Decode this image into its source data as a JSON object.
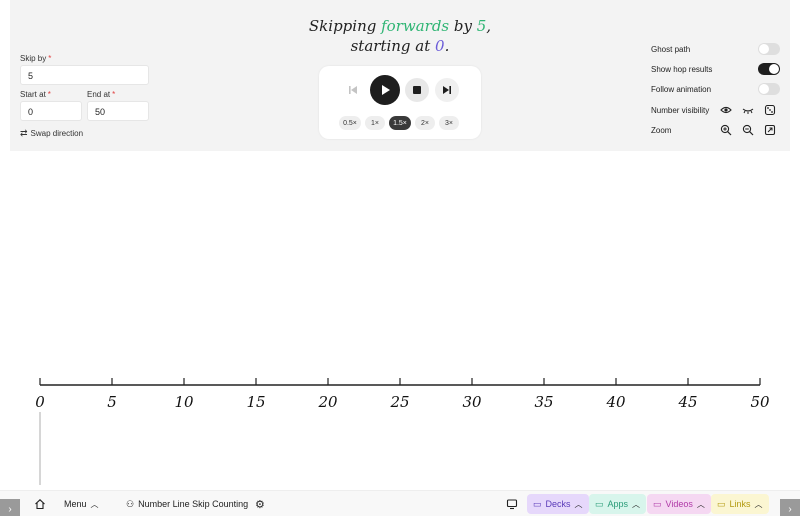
{
  "title": {
    "line1_pre": "Skipping ",
    "line1_dir": "forwards",
    "line1_mid": " by ",
    "line1_step": "5",
    "line1_end": ",",
    "line2_pre": "starting at ",
    "line2_start": "0",
    "line2_end": "."
  },
  "form": {
    "skip_by_label": "Skip by",
    "skip_by_value": "5",
    "start_at_label": "Start at",
    "start_at_value": "0",
    "end_at_label": "End at",
    "end_at_value": "50",
    "required_mark": "*",
    "swap_label": "Swap direction"
  },
  "playback": {
    "speeds": [
      "0.5×",
      "1×",
      "1.5×",
      "2×",
      "3×"
    ],
    "active_speed": "1.5×"
  },
  "options": {
    "ghost_path": {
      "label": "Ghost path",
      "on": false
    },
    "show_hop_results": {
      "label": "Show hop results",
      "on": true
    },
    "follow_animation": {
      "label": "Follow animation",
      "on": false
    },
    "number_visibility_label": "Number visibility",
    "zoom_label": "Zoom"
  },
  "number_line": {
    "min": 0,
    "max": 50,
    "labels": [
      "0",
      "5",
      "10",
      "15",
      "20",
      "25",
      "30",
      "35",
      "40",
      "45",
      "50"
    ]
  },
  "bottom_bar": {
    "menu_label": "Menu",
    "activity_title": "Number Line Skip Counting",
    "decks_label": "Decks",
    "apps_label": "Apps",
    "videos_label": "Videos",
    "links_label": "Links"
  },
  "colors": {
    "accent_green": "#2fb574",
    "accent_purple": "#6b5cd8",
    "decks_bg": "#e6d8fb",
    "apps_bg": "#d8f5ec",
    "videos_bg": "#f5d8f2",
    "links_bg": "#fbf6d2"
  }
}
